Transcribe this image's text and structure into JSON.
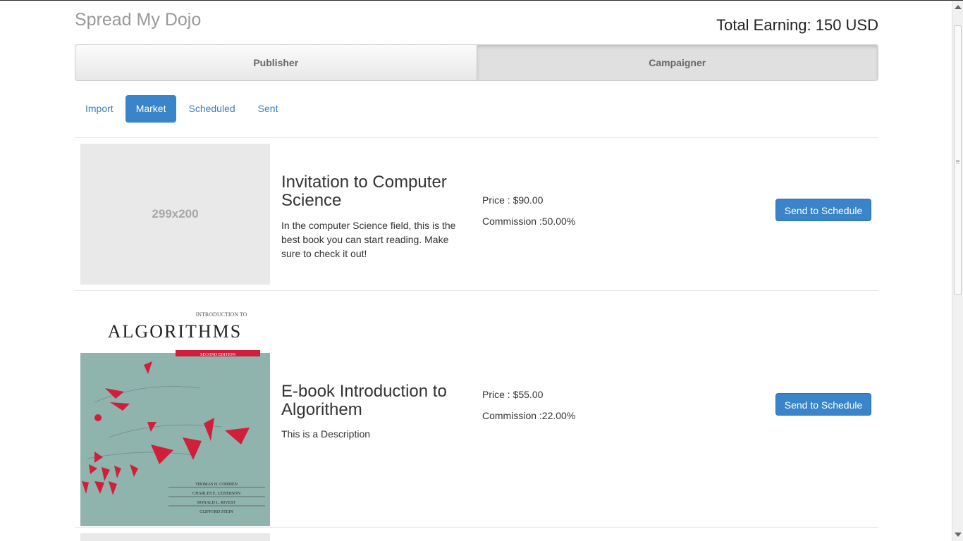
{
  "header": {
    "brand": "Spread My Dojo",
    "total_earning": "Total Earning: 150 USD"
  },
  "role_toggle": {
    "publisher_label": "Publisher",
    "campaigner_label": "Campaigner",
    "active": "Campaigner"
  },
  "nav": {
    "items": [
      {
        "label": "Import",
        "active": false
      },
      {
        "label": "Market",
        "active": true
      },
      {
        "label": "Scheduled",
        "active": false
      },
      {
        "label": "Sent",
        "active": false
      }
    ]
  },
  "products": [
    {
      "image_placeholder": "299x200",
      "title": "Invitation to Computer Science",
      "description": "In the computer Science field, this is the best book you can start reading. Make sure to check it out!",
      "price": "Price : $90.00",
      "commission": "Commission :50.00%",
      "button_label": "Send to Schedule"
    },
    {
      "cover": {
        "top_line": "INTRODUCTION TO",
        "main_title": "ALGORITHMS",
        "edition": "SECOND EDITION",
        "authors": [
          "THOMAS H. CORMEN",
          "CHARLES E. LEISERSON",
          "RONALD L. RIVEST",
          "CLIFFORD STEIN"
        ],
        "background_color": "#8fb3ad",
        "accent_color": "#d11f3a"
      },
      "title": "E-book Introduction to Algorithem",
      "description": "This is a Description",
      "price": "Price : $55.00",
      "commission": "Commission :22.00%",
      "button_label": "Send to Schedule"
    }
  ],
  "colors": {
    "primary": "#3a84c9",
    "link": "#3a7fc0",
    "brand_text": "#999999"
  }
}
